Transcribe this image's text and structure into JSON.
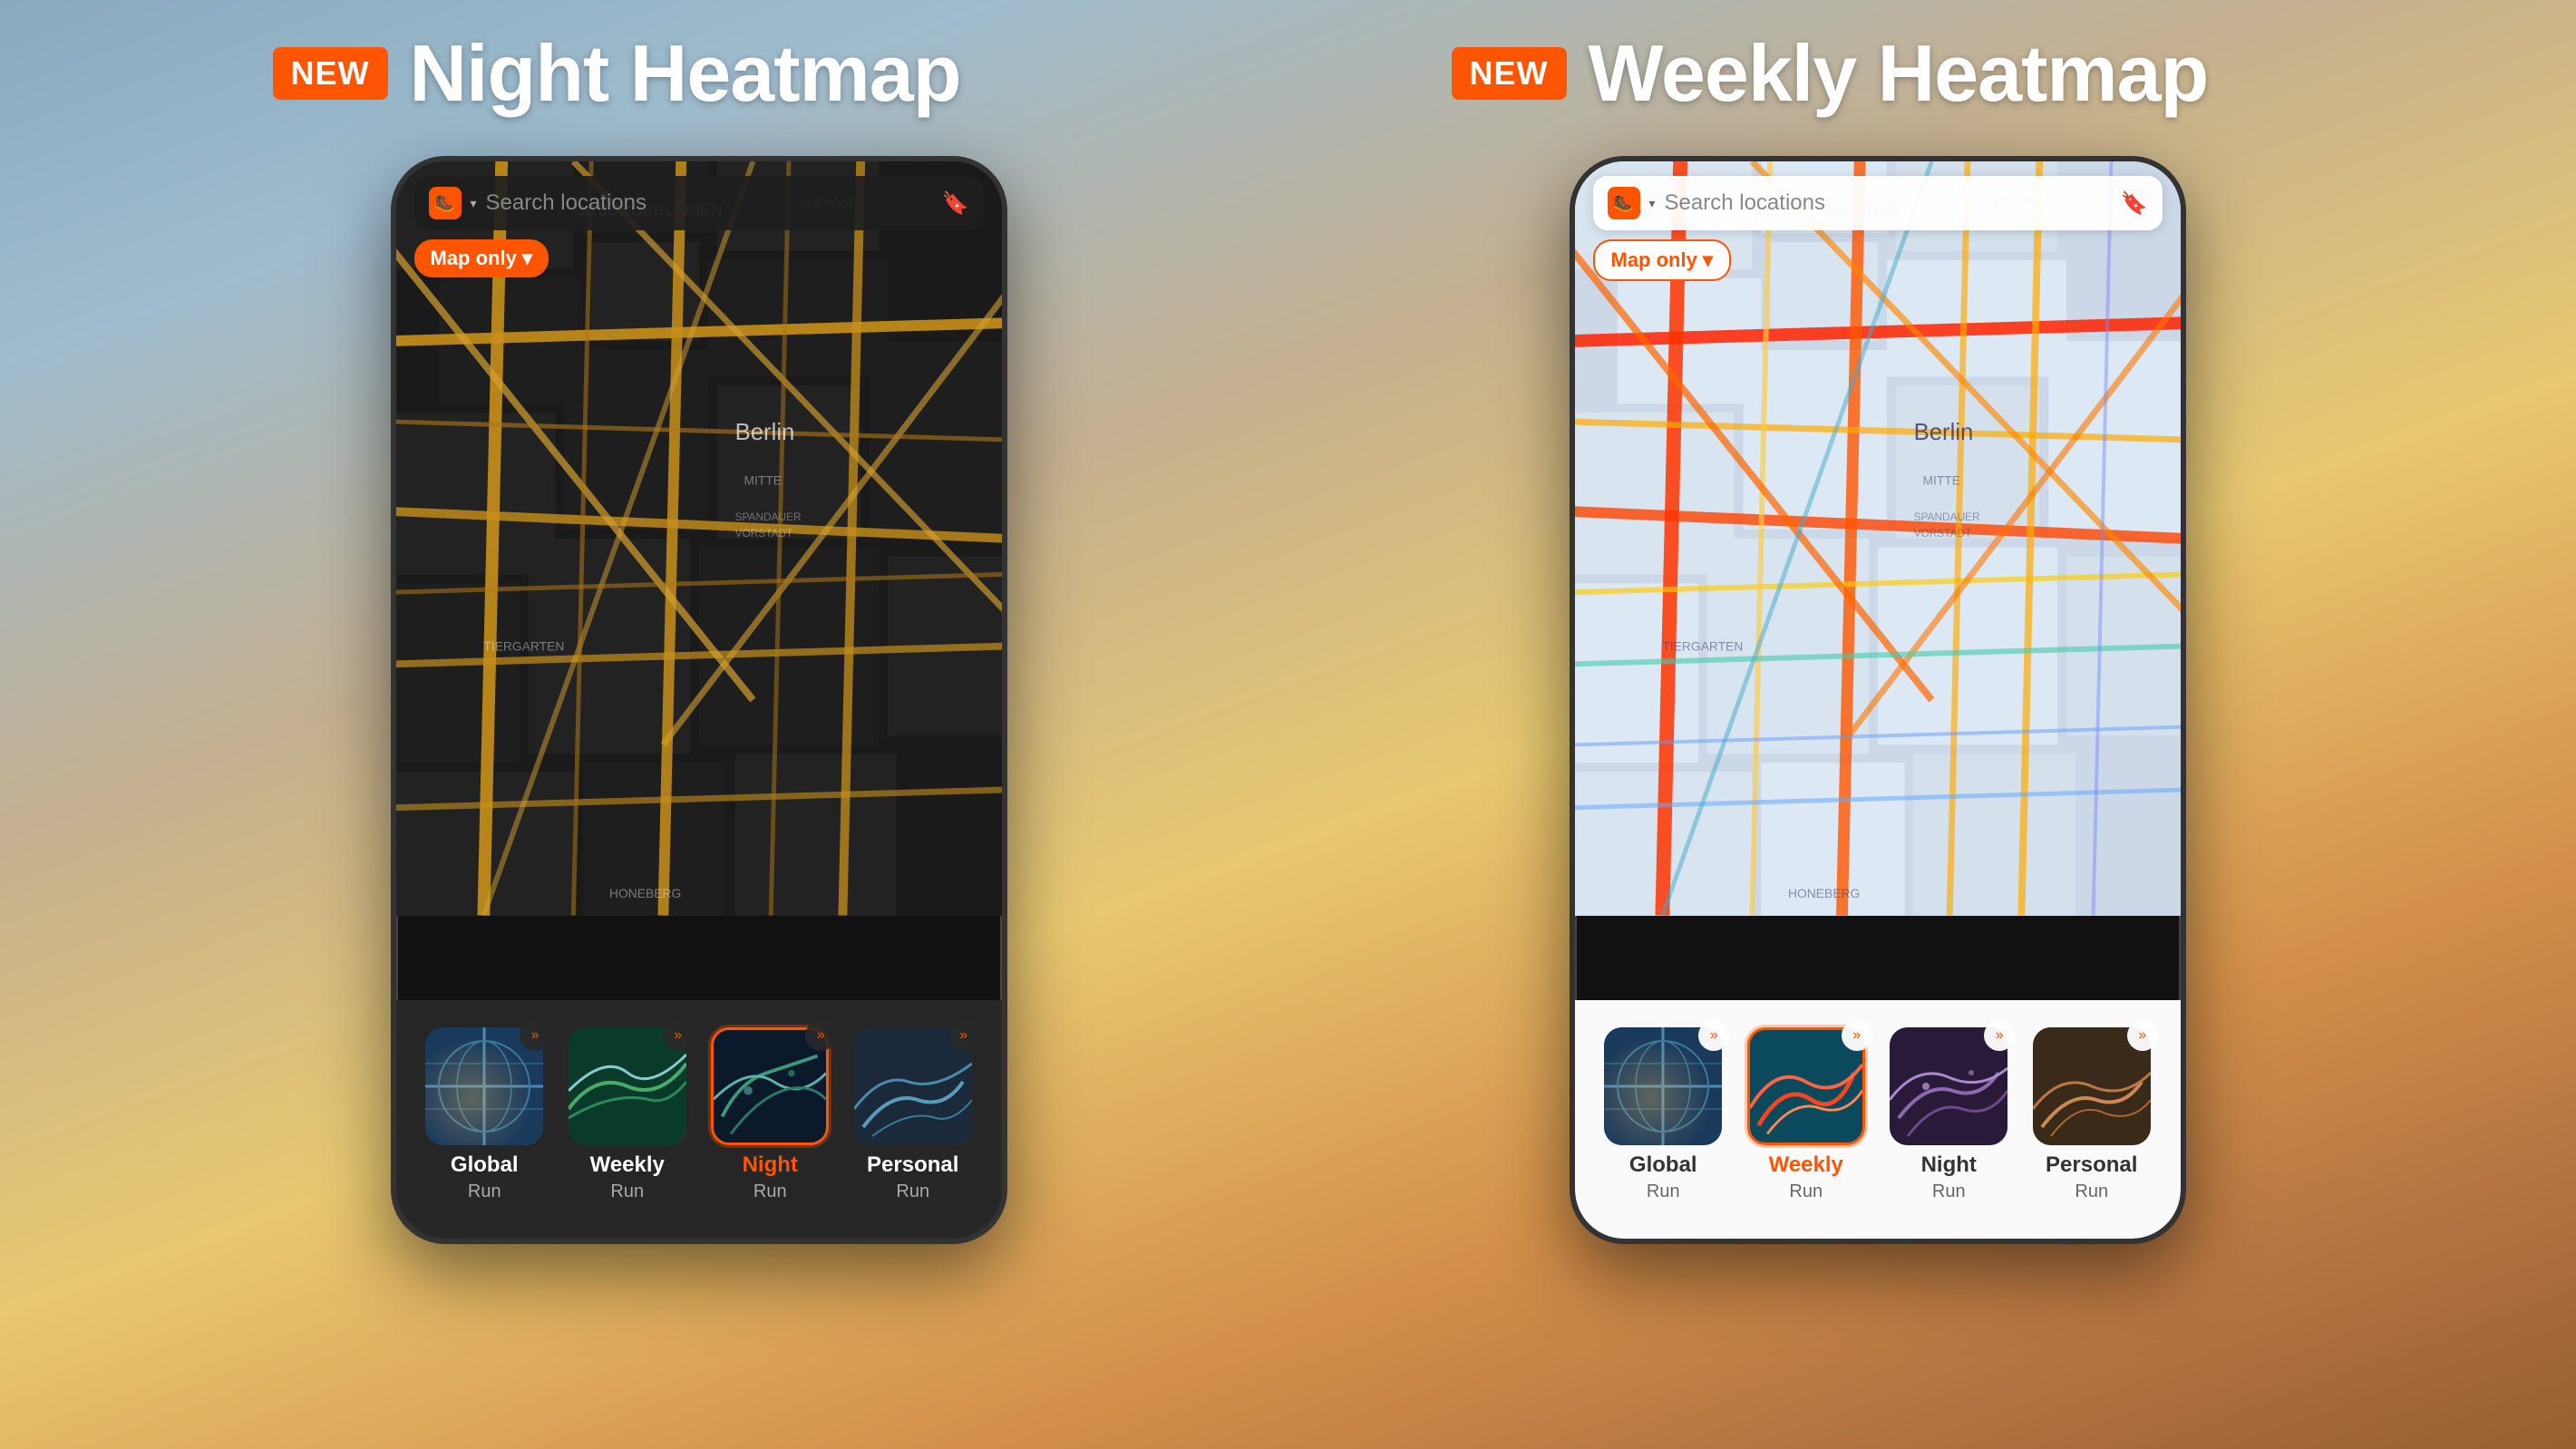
{
  "left_section": {
    "badge": "NEW",
    "title": "Night Heatmap",
    "phone": {
      "search_placeholder": "Search locations",
      "map_only_label": "Map only",
      "berlin_label": "Berlin",
      "heatmap_items": [
        {
          "id": "global",
          "label": "Global",
          "sublabel": "Run",
          "active": false
        },
        {
          "id": "weekly",
          "label": "Weekly",
          "sublabel": "Run",
          "active": false
        },
        {
          "id": "night",
          "label": "Night",
          "sublabel": "Run",
          "active": true
        },
        {
          "id": "personal",
          "label": "Personal",
          "sublabel": "Run",
          "active": false
        }
      ]
    }
  },
  "right_section": {
    "badge": "NEW",
    "title": "Weekly Heatmap",
    "phone": {
      "search_placeholder": "Search locations",
      "map_only_label": "Map only",
      "berlin_label": "Berlin",
      "heatmap_items": [
        {
          "id": "global",
          "label": "Global",
          "sublabel": "Run",
          "active": false
        },
        {
          "id": "weekly",
          "label": "Weekly",
          "sublabel": "Run",
          "active": true
        },
        {
          "id": "night",
          "label": "Night",
          "sublabel": "Run",
          "active": false
        },
        {
          "id": "personal",
          "label": "Personal",
          "sublabel": "Run",
          "active": false
        }
      ]
    }
  },
  "colors": {
    "accent": "#ff5500",
    "dark_bg": "#1a1a1a",
    "light_bg": "#c8d8e8",
    "card_dark": "rgba(40,40,40,0.95)",
    "card_light": "rgba(255,255,255,0.98)"
  }
}
